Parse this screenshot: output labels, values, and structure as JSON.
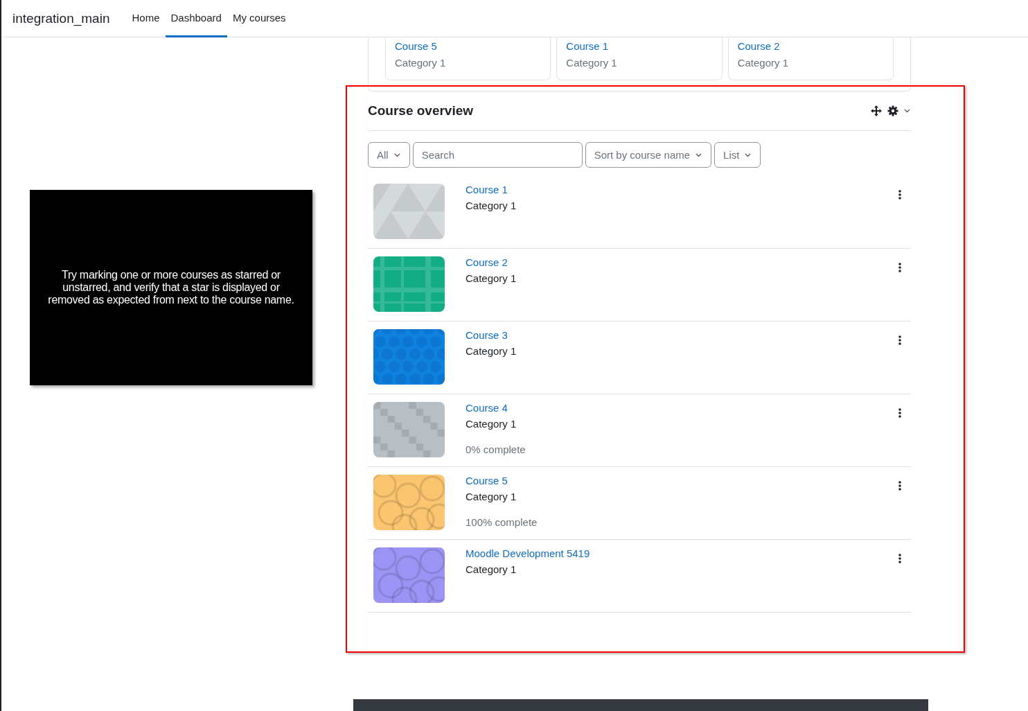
{
  "navbar": {
    "site_name": "integration_main",
    "links": [
      {
        "label": "Home",
        "selected": false
      },
      {
        "label": "Dashboard",
        "selected": true
      },
      {
        "label": "My courses",
        "selected": false
      }
    ]
  },
  "recent_courses": [
    {
      "name": "Course 5",
      "category": "Category 1"
    },
    {
      "name": "Course 1",
      "category": "Category 1"
    },
    {
      "name": "Course 2",
      "category": "Category 1"
    }
  ],
  "course_overview": {
    "title": "Course overview",
    "filters": {
      "grouping": "All",
      "search_placeholder": "Search",
      "sort": "Sort by course name",
      "view": "List"
    },
    "courses": [
      {
        "name": "Course 1",
        "category": "Category 1",
        "kind": "triangles",
        "color": "#d4d9dc"
      },
      {
        "name": "Course 2",
        "category": "Category 1",
        "kind": "plaid",
        "color": "#12ad84"
      },
      {
        "name": "Course 3",
        "category": "Category 1",
        "kind": "dots",
        "color": "#0f82e0"
      },
      {
        "name": "Course 4",
        "category": "Category 1",
        "kind": "pixels",
        "color": "#b8bfc4",
        "progress": "0% complete"
      },
      {
        "name": "Course 5",
        "category": "Category 1",
        "kind": "rings",
        "color": "#fbc46e",
        "progress": "100% complete"
      },
      {
        "name": "Moodle Development 5419",
        "category": "Category 1",
        "kind": "rings",
        "color": "#9c94f4"
      }
    ]
  },
  "callout": {
    "text": "Try marking one or more courses as starred or unstarred, and verify that a star is displayed or removed as expected from next to the course name."
  }
}
